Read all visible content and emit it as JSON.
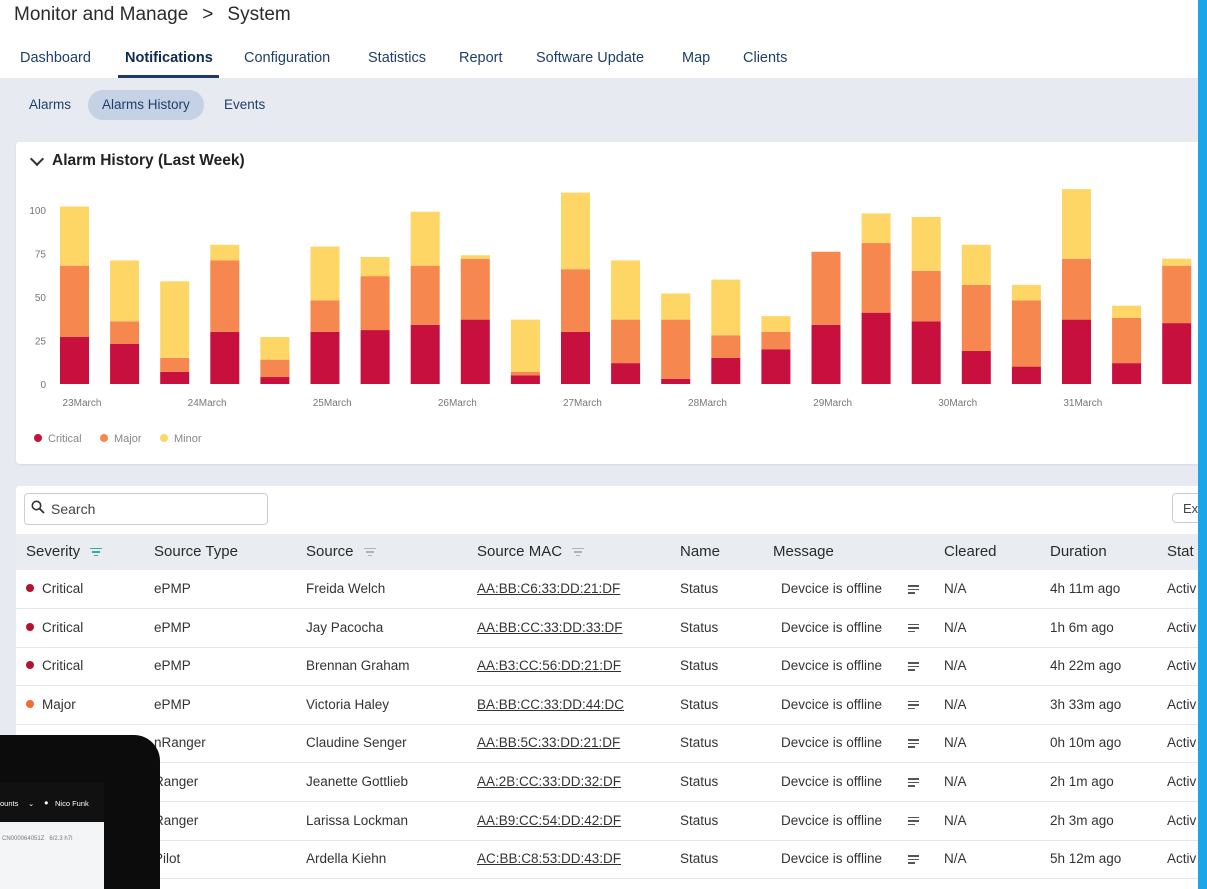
{
  "breadcrumb": {
    "parent": "Monitor and Manage",
    "separator": ">",
    "current": "System"
  },
  "tabs": [
    "Dashboard",
    "Notifications",
    "Configuration",
    "Statistics",
    "Report",
    "Software Update",
    "Map",
    "Clients"
  ],
  "active_tab": "Notifications",
  "subtabs": [
    "Alarms",
    "Alarms History",
    "Events"
  ],
  "active_subtab": "Alarms History",
  "chart_card": {
    "title": "Alarm History (Last Week)"
  },
  "chart_data": {
    "type": "bar",
    "stacked": true,
    "title": "Alarm History (Last Week)",
    "x_tick_labels": [
      "23March",
      "24March",
      "25March",
      "26March",
      "27March",
      "28March",
      "29March",
      "30March",
      "31March"
    ],
    "y_ticks": [
      0,
      25,
      50,
      75,
      100
    ],
    "ylim": [
      0,
      115
    ],
    "grid": false,
    "legend_position": "bottom-left",
    "series": [
      {
        "name": "Critical",
        "color": "#c8103e",
        "values": [
          27,
          23,
          7,
          30,
          4,
          30,
          31,
          34,
          37,
          5,
          30,
          12,
          3,
          15,
          20,
          34,
          41,
          36,
          19,
          10,
          37,
          12,
          35
        ]
      },
      {
        "name": "Major",
        "color": "#f5874f",
        "values": [
          41,
          13,
          8,
          41,
          10,
          18,
          31,
          34,
          35,
          2,
          36,
          25,
          34,
          13,
          10,
          42,
          40,
          29,
          38,
          38,
          35,
          26,
          33
        ]
      },
      {
        "name": "Minor",
        "color": "#fdd666",
        "values": [
          34,
          35,
          44,
          9,
          13,
          31,
          11,
          31,
          2,
          30,
          44,
          34,
          15,
          32,
          9,
          0,
          17,
          31,
          23,
          9,
          40,
          7,
          4
        ]
      }
    ]
  },
  "search": {
    "placeholder": "Search"
  },
  "export_label": "Ex",
  "table": {
    "columns": [
      "Severity",
      "Source Type",
      "Source",
      "Source MAC",
      "Name",
      "Message",
      "Cleared",
      "Duration",
      "Stat"
    ],
    "rows": [
      {
        "severity": "Critical",
        "source_type": "ePMP",
        "source": "Freida Welch",
        "mac": "AA:BB:C6:33:DD:21:DF",
        "name": "Status",
        "message": "Devcice is offline",
        "cleared": "N/A",
        "duration": "4h 11m ago",
        "status": "Activ"
      },
      {
        "severity": "Critical",
        "source_type": "ePMP",
        "source": "Jay Pacocha",
        "mac": "AA:BB:CC:33:DD:33:DF",
        "name": "Status",
        "message": "Devcice is offline",
        "cleared": "N/A",
        "duration": "1h 6m ago",
        "status": "Activ"
      },
      {
        "severity": "Critical",
        "source_type": "ePMP",
        "source": "Brennan Graham",
        "mac": "AA:B3:CC:56:DD:21:DF",
        "name": "Status",
        "message": "Devcice is offline",
        "cleared": "N/A",
        "duration": "4h 22m ago",
        "status": "Activ"
      },
      {
        "severity": "Major",
        "source_type": "ePMP",
        "source": "Victoria Haley",
        "mac": "BA:BB:CC:33:DD:44:DC",
        "name": "Status",
        "message": "Devcice is offline",
        "cleared": "N/A",
        "duration": "3h 33m ago",
        "status": "Activ"
      },
      {
        "severity": "",
        "source_type": "nRanger",
        "source": "Claudine Senger",
        "mac": "AA:BB:5C:33:DD:21:DF",
        "name": "Status",
        "message": "Devcice is offline",
        "cleared": "N/A",
        "duration": "0h 10m ago",
        "status": "Activ"
      },
      {
        "severity": "",
        "source_type": "Ranger",
        "source": "Jeanette Gottlieb",
        "mac": "AA:2B:CC:33:DD:32:DF",
        "name": "Status",
        "message": "Devcice is offline",
        "cleared": "N/A",
        "duration": "2h 1m ago",
        "status": "Activ"
      },
      {
        "severity": "",
        "source_type": "Ranger",
        "source": "Larissa Lockman",
        "mac": "AA:B9:CC:54:DD:42:DF",
        "name": "Status",
        "message": "Devcice is offline",
        "cleared": "N/A",
        "duration": "2h 3m ago",
        "status": "Activ"
      },
      {
        "severity": "",
        "source_type": "Pilot",
        "source": "Ardella Kiehn",
        "mac": "AC:BB:C8:53:DD:43:DF",
        "name": "Status",
        "message": "Devcice is offline",
        "cleared": "N/A",
        "duration": "5h 12m ago",
        "status": "Activ"
      }
    ]
  },
  "severity_colors": {
    "Critical": "#b5122e",
    "Major": "#f26b30"
  },
  "device": {
    "menu_left": "ounts",
    "user": "Nico Funk",
    "row_id": "CN000064051Z",
    "row_value": "6/2.3 h7l"
  }
}
